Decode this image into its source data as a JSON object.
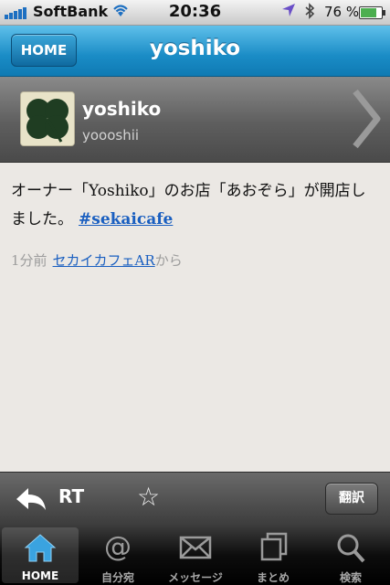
{
  "status": {
    "carrier": "SoftBank",
    "time": "20:36",
    "battery": "76 %",
    "battery_level": 0.76
  },
  "nav": {
    "back_label": "HOME",
    "title": "yoshiko"
  },
  "profile": {
    "name": "yoshiko",
    "handle": "yoooshii"
  },
  "tweet": {
    "text": "オーナー「Yoshiko」のお店「あおぞら」が開店しました。",
    "hashtag": "#sekaicafe",
    "time_ago": "1分前",
    "source": "セカイカフェAR",
    "source_suffix": "から"
  },
  "actions": {
    "retweet_label": "RT",
    "translate_label": "翻訳"
  },
  "tabs": [
    {
      "label": "HOME",
      "icon": "home-icon"
    },
    {
      "label": "自分宛",
      "icon": "at-icon"
    },
    {
      "label": "メッセージ",
      "icon": "envelope-icon"
    },
    {
      "label": "まとめ",
      "icon": "stack-icon"
    },
    {
      "label": "検索",
      "icon": "search-icon"
    }
  ],
  "colors": {
    "accent": "#1a8cc6",
    "link": "#1a5fc0"
  }
}
